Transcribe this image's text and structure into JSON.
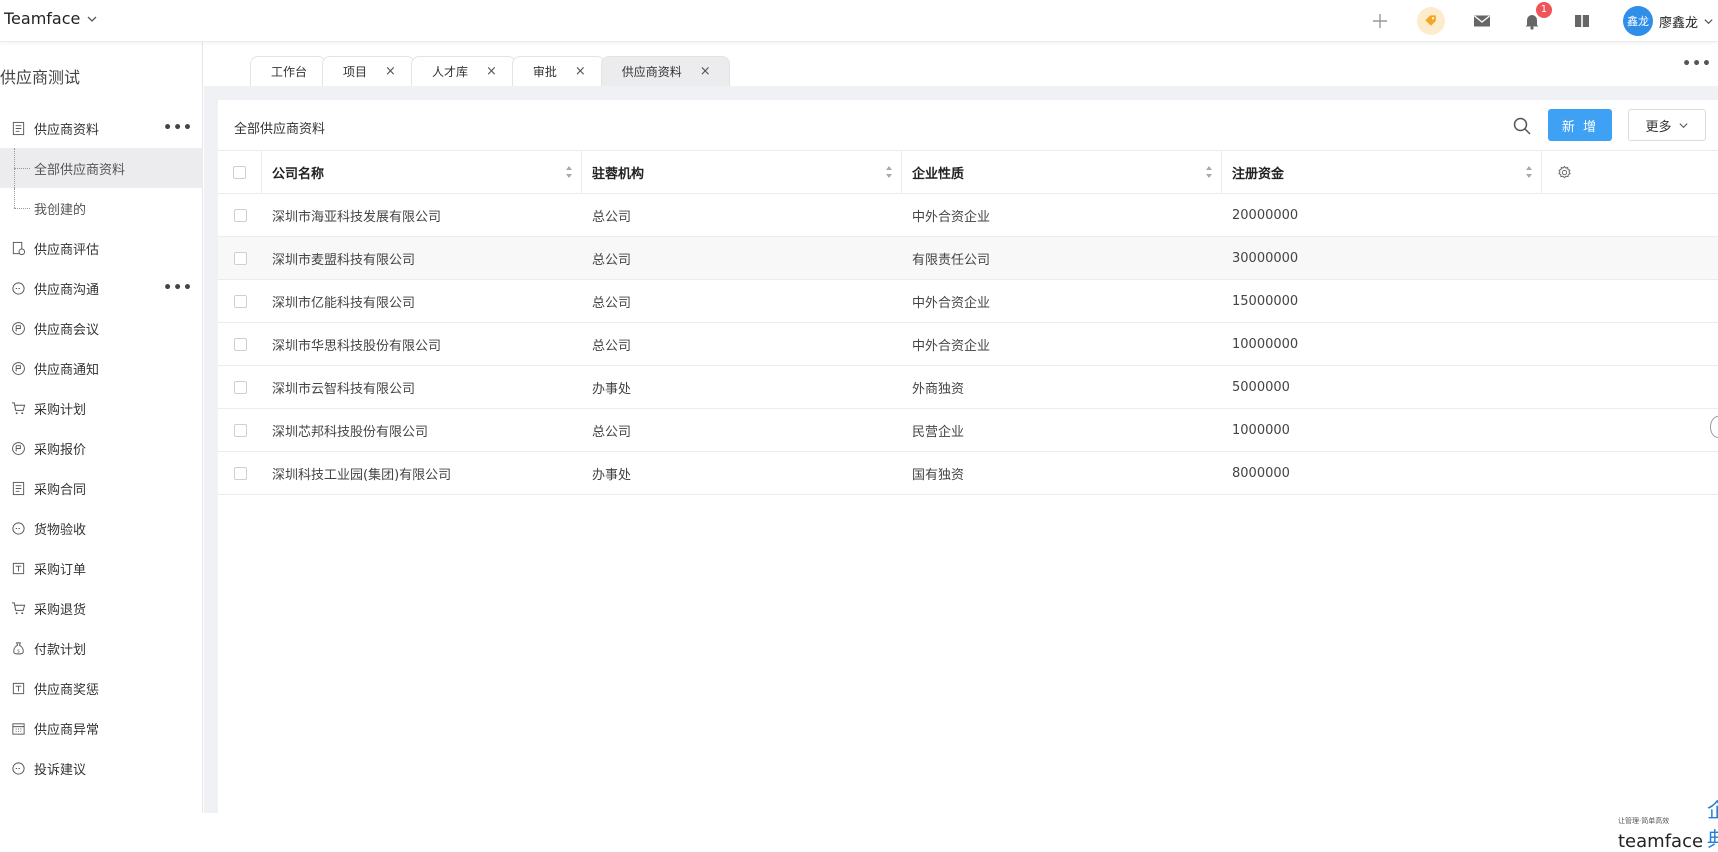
{
  "app": {
    "name": "Teamface"
  },
  "top_icons": [
    "plus-icon",
    "tag-icon",
    "mail-icon",
    "bell-icon",
    "book-icon"
  ],
  "notifications": {
    "count": "1"
  },
  "user": {
    "avatar_text": "鑫龙",
    "name": "廖鑫龙"
  },
  "sidebar": {
    "title": "供应商测试",
    "items": [
      {
        "label": "供应商资料",
        "icon": "document-icon",
        "more": "•••"
      },
      {
        "label": "全部供应商资料",
        "sub": true,
        "active": true
      },
      {
        "label": "我创建的",
        "sub": true
      },
      {
        "label": "供应商评估",
        "icon": "evaluate-icon"
      },
      {
        "label": "供应商沟通",
        "icon": "chat-icon",
        "more": "•••"
      },
      {
        "label": "供应商会议",
        "icon": "meeting-icon"
      },
      {
        "label": "供应商通知",
        "icon": "notice-icon"
      },
      {
        "label": "采购计划",
        "icon": "cart-icon"
      },
      {
        "label": "采购报价",
        "icon": "quote-icon"
      },
      {
        "label": "采购合同",
        "icon": "contract-icon"
      },
      {
        "label": "货物验收",
        "icon": "acceptance-icon"
      },
      {
        "label": "采购订单",
        "icon": "order-icon"
      },
      {
        "label": "采购退货",
        "icon": "return-cart-icon"
      },
      {
        "label": "付款计划",
        "icon": "moneybag-icon"
      },
      {
        "label": "供应商奖惩",
        "icon": "reward-icon"
      },
      {
        "label": "供应商异常",
        "icon": "calendar-icon"
      },
      {
        "label": "投诉建议",
        "icon": "complaint-icon"
      }
    ]
  },
  "tabs": [
    {
      "label": "工作台",
      "closable": false
    },
    {
      "label": "项目",
      "closable": true
    },
    {
      "label": "人才库",
      "closable": true
    },
    {
      "label": "审批",
      "closable": true
    },
    {
      "label": "供应商资料",
      "closable": true,
      "active": true
    }
  ],
  "tab_close": "×",
  "tab_more": "•••",
  "panel": {
    "title": "全部供应商资料",
    "new_button": "新 增",
    "more_button": "更多"
  },
  "table": {
    "columns": [
      "公司名称",
      "驻蓉机构",
      "企业性质",
      "注册资金"
    ],
    "rows": [
      [
        "深圳市海亚科技发展有限公司",
        "总公司",
        "中外合资企业",
        "20000000"
      ],
      [
        "深圳市麦盟科技有限公司",
        "总公司",
        "有限责任公司",
        "30000000"
      ],
      [
        "深圳市亿能科技有限公司",
        "总公司",
        "中外合资企业",
        "15000000"
      ],
      [
        "深圳市华思科技股份有限公司",
        "总公司",
        "中外合资企业",
        "10000000"
      ],
      [
        "深圳市云智科技有限公司",
        "办事处",
        "外商独资",
        "5000000"
      ],
      [
        "深圳芯邦科技股份有限公司",
        "总公司",
        "民营企业",
        "1000000"
      ],
      [
        "深圳科技工业园(集团)有限公司",
        "办事处",
        "国有独资",
        "8000000"
      ]
    ]
  },
  "watermark": {
    "en": "teamface",
    "cn": "企典",
    "slogan": "让管理·简单高效"
  },
  "colors": {
    "primary": "#3ea1f3",
    "badge": "#f0535a",
    "avatar": "#2f8fe8"
  }
}
